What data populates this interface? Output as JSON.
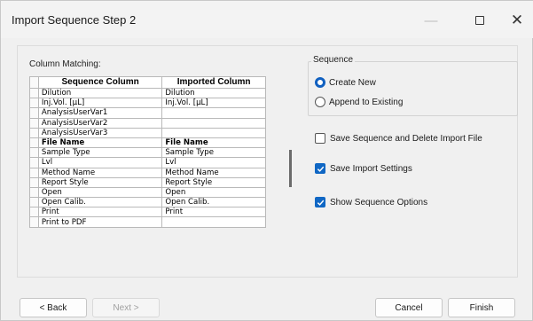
{
  "window": {
    "title": "Import Sequence Step 2",
    "minimize_glyph": "—",
    "close_glyph": "✕"
  },
  "column_matching": {
    "label": "Column Matching:",
    "headers": [
      "Sequence Column",
      "Imported Column"
    ],
    "rows": [
      {
        "sequence": "Dilution",
        "imported": "Dilution",
        "bold": false
      },
      {
        "sequence": "Inj.Vol. [µL]",
        "imported": "Inj.Vol. [µL]",
        "bold": false
      },
      {
        "sequence": "AnalysisUserVar1",
        "imported": "",
        "bold": false
      },
      {
        "sequence": "AnalysisUserVar2",
        "imported": "",
        "bold": false
      },
      {
        "sequence": "AnalysisUserVar3",
        "imported": "",
        "bold": false
      },
      {
        "sequence": "File Name",
        "imported": "File Name",
        "bold": true
      },
      {
        "sequence": "Sample Type",
        "imported": "Sample Type",
        "bold": false
      },
      {
        "sequence": "Lvl",
        "imported": "Lvl",
        "bold": false
      },
      {
        "sequence": "Method Name",
        "imported": "Method Name",
        "bold": false
      },
      {
        "sequence": "Report Style",
        "imported": "Report Style",
        "bold": false
      },
      {
        "sequence": "Open",
        "imported": "Open",
        "bold": false
      },
      {
        "sequence": "Open Calib.",
        "imported": "Open Calib.",
        "bold": false
      },
      {
        "sequence": "Print",
        "imported": "Print",
        "bold": false
      },
      {
        "sequence": "Print to PDF",
        "imported": "",
        "bold": false
      }
    ]
  },
  "sequence_group": {
    "title": "Sequence",
    "create_new": "Create New",
    "append_existing": "Append to Existing",
    "selected": "Create New"
  },
  "options": {
    "save_delete": {
      "label": "Save Sequence and Delete Import File",
      "checked": false
    },
    "save_settings": {
      "label": "Save Import Settings",
      "checked": true
    },
    "show_options": {
      "label": "Show Sequence Options",
      "checked": true
    }
  },
  "buttons": {
    "back": "< Back",
    "next": "Next >",
    "cancel": "Cancel",
    "finish": "Finish"
  },
  "colors": {
    "accent": "#1067c4",
    "window_bg": "#f0f0f0"
  }
}
